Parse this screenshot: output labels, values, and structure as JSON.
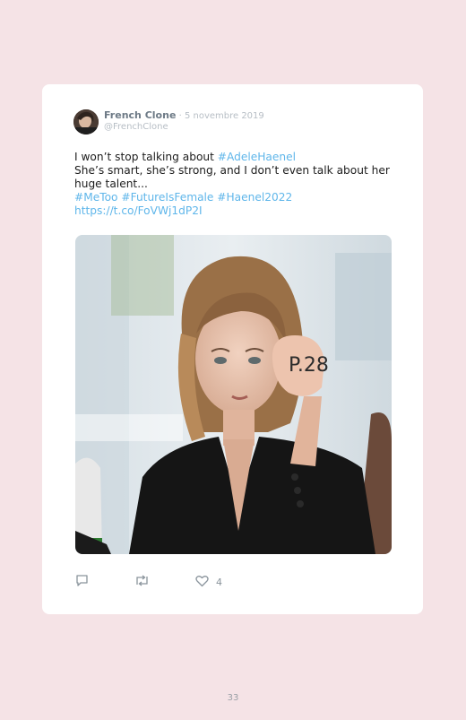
{
  "tweet": {
    "author_name": "French Clone",
    "date": " · 5 novembre 2019",
    "handle": "@FrenchClone",
    "line1_text": "I won’t stop talking about ",
    "line1_hashtag": "#AdeleHaenel",
    "line2": "She’s smart, she’s strong, and I don’t even talk about her huge talent...",
    "hashtags": "#MeToo #FutureIsFemale #Haenel2022",
    "url": "https://t.co/FoVWj1dP2I",
    "hand_writing": "P.28",
    "likes": "4"
  },
  "icons": {
    "reply": "reply-icon",
    "retweet": "retweet-icon",
    "like": "heart-icon"
  },
  "colors": {
    "background": "#f5e3e6",
    "card": "#ffffff",
    "link": "#5fb6ea"
  },
  "page": {
    "number": "33"
  }
}
